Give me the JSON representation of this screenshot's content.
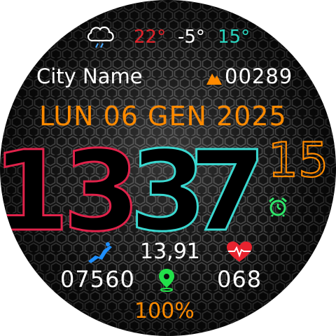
{
  "weather": {
    "icon": "cloud-rain-icon",
    "temp_high": "22°",
    "temp_current": "-5°",
    "temp_low": "15°",
    "colors": {
      "high": "#e0222a",
      "current": "#ffffff",
      "low": "#28d6c0"
    }
  },
  "location": {
    "city": "City Name",
    "altitude_icon": "mountain-icon",
    "altitude": "00289"
  },
  "date": {
    "text": "LUN 06 GEN 2025",
    "color": "#ff8a00"
  },
  "time": {
    "hour_tens": "1",
    "hour_ones": "3",
    "minute_tens": "3",
    "minute_ones": "7",
    "seconds": "15",
    "colors": {
      "hour_tens": "#000000",
      "hour_tens_outline": "#e0224a",
      "hour_ones": "#000000",
      "hour_ones_outline": "#e0224a",
      "minute_tens": "#000000",
      "minute_tens_outline": "#3ad8d0",
      "minute_ones": "#000000",
      "minute_ones_outline": "#3ad8d0",
      "seconds_outline": "#ff8a00"
    }
  },
  "alarm": {
    "icon": "alarm-clock-icon",
    "color": "#2ee66a"
  },
  "activity": {
    "run_icon": "running-icon",
    "distance": "13,91",
    "steps": "07560",
    "location_icon": "map-pin-icon",
    "heart_icon": "heart-rate-icon",
    "heart_rate": "068"
  },
  "battery": {
    "text": "100%",
    "color": "#ff8a00"
  }
}
